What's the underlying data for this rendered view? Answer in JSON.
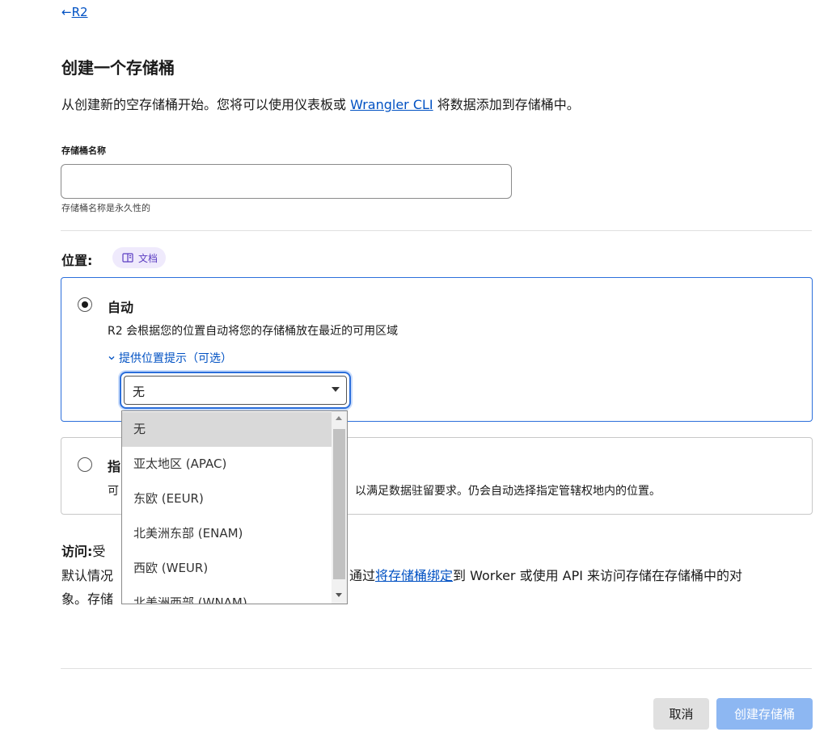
{
  "back": {
    "arrow": "←",
    "label": "R2"
  },
  "title": "创建一个存储桶",
  "intro": {
    "before": "从创建新的空存储桶开始。您将可以使用仪表板或 ",
    "link": "Wrangler CLI",
    "after": " 将数据添加到存储桶中。"
  },
  "bucket_name": {
    "label": "存储桶名称",
    "value": "",
    "help": "存储桶名称是永久性的"
  },
  "location": {
    "heading": "位置:",
    "docs_badge": "文档",
    "docs_icon": "book-icon",
    "auto": {
      "title": "自动",
      "description": "R2 会根据您的位置自动将您的存储桶放在最近的可用区域",
      "hint_toggle": "提供位置提示（可选）",
      "select_value": "无",
      "options": [
        "无",
        "亚太地区 (APAC)",
        "东欧 (EEUR)",
        "北美洲东部 (ENAM)",
        "西欧 (WEUR)",
        "北美洲西部 (WNAM)"
      ]
    },
    "specific": {
      "title_partial": "指",
      "desc_partial": "可",
      "desc_tail": "以满足数据驻留要求。仍会自动选择指定管辖权地内的位置。"
    }
  },
  "access": {
    "heading": "访问:",
    "heading_tail": "受",
    "line2_partial": "默认情况",
    "line2_pre": "通过",
    "line2_link": "将存储桶绑定",
    "line2_post": "到 Worker 或使用 API 来访问存储在存储桶中的对",
    "line3_partial": "象。存储"
  },
  "buttons": {
    "cancel": "取消",
    "create": "创建存储桶"
  },
  "colors": {
    "link": "#0051c3",
    "accent": "#2c6fdb",
    "badge_bg": "#efeafc",
    "create_btn": "#8db7f2"
  }
}
